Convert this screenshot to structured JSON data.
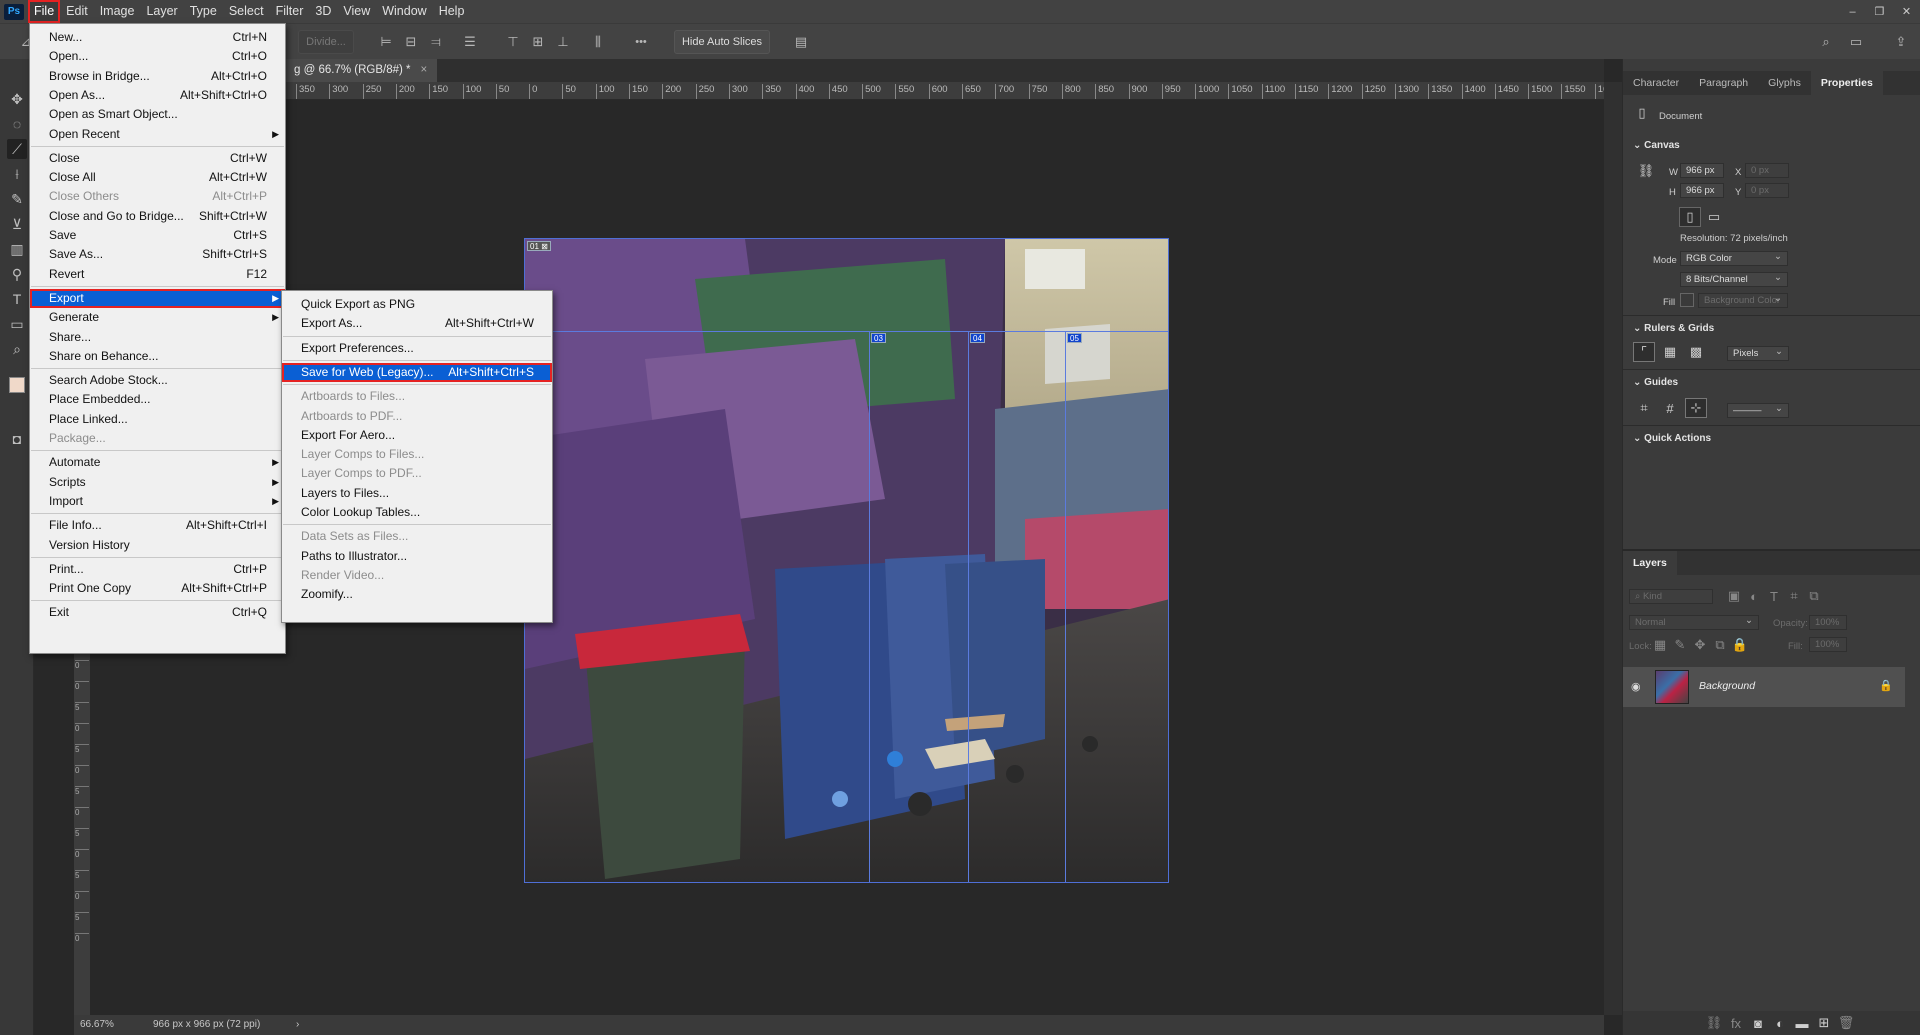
{
  "app": {
    "logo": "Ps"
  },
  "menubar": {
    "items": [
      "File",
      "Edit",
      "Image",
      "Layer",
      "Type",
      "Select",
      "Filter",
      "3D",
      "View",
      "Window",
      "Help"
    ]
  },
  "window_controls": {
    "minimize": "–",
    "restore": "❐",
    "close": "✕"
  },
  "options_bar": {
    "divide_label": "Divide...",
    "hide_auto_slices_label": "Hide Auto Slices",
    "more_label": "•••"
  },
  "document": {
    "tab_title": "g @ 66.7% (RGB/8#) *",
    "close_glyph": "×"
  },
  "rulers": {
    "h_labels": [
      "350",
      "300",
      "250",
      "200",
      "150",
      "100",
      "50",
      "0",
      "50",
      "100",
      "150",
      "200",
      "250",
      "300",
      "350",
      "400",
      "450",
      "500",
      "550",
      "600",
      "650",
      "700",
      "750",
      "800",
      "850",
      "900",
      "950",
      "1000",
      "1050",
      "1100",
      "1150",
      "1200",
      "1250",
      "1300",
      "1350",
      "1400",
      "1450",
      "1500",
      "1550",
      "16"
    ],
    "v_labels": [
      "0",
      "0",
      "5",
      "0",
      "5",
      "0",
      "5",
      "0",
      "5",
      "0",
      "5",
      "0",
      "5",
      "0"
    ]
  },
  "status_bar": {
    "zoom": "66.67%",
    "doc_info": "966 px x 966 px (72 ppi)",
    "arrow": "›"
  },
  "slices": [
    {
      "label": "03"
    },
    {
      "label": "04"
    },
    {
      "label": "05"
    }
  ],
  "file_menu": {
    "groups": [
      [
        {
          "label": "New...",
          "shortcut": "Ctrl+N"
        },
        {
          "label": "Open...",
          "shortcut": "Ctrl+O"
        },
        {
          "label": "Browse in Bridge...",
          "shortcut": "Alt+Ctrl+O"
        },
        {
          "label": "Open As...",
          "shortcut": "Alt+Shift+Ctrl+O"
        },
        {
          "label": "Open as Smart Object...",
          "shortcut": ""
        },
        {
          "label": "Open Recent",
          "shortcut": "",
          "submenu": true
        }
      ],
      [
        {
          "label": "Close",
          "shortcut": "Ctrl+W"
        },
        {
          "label": "Close All",
          "shortcut": "Alt+Ctrl+W"
        },
        {
          "label": "Close Others",
          "shortcut": "Alt+Ctrl+P",
          "disabled": true
        },
        {
          "label": "Close and Go to Bridge...",
          "shortcut": "Shift+Ctrl+W"
        },
        {
          "label": "Save",
          "shortcut": "Ctrl+S"
        },
        {
          "label": "Save As...",
          "shortcut": "Shift+Ctrl+S"
        },
        {
          "label": "Revert",
          "shortcut": "F12"
        }
      ],
      [
        {
          "label": "Export",
          "shortcut": "",
          "submenu": true,
          "highlighted": true
        },
        {
          "label": "Generate",
          "shortcut": "",
          "submenu": true
        },
        {
          "label": "Share...",
          "shortcut": ""
        },
        {
          "label": "Share on Behance...",
          "shortcut": ""
        }
      ],
      [
        {
          "label": "Search Adobe Stock...",
          "shortcut": ""
        },
        {
          "label": "Place Embedded...",
          "shortcut": ""
        },
        {
          "label": "Place Linked...",
          "shortcut": ""
        },
        {
          "label": "Package...",
          "shortcut": "",
          "disabled": true
        }
      ],
      [
        {
          "label": "Automate",
          "shortcut": "",
          "submenu": true
        },
        {
          "label": "Scripts",
          "shortcut": "",
          "submenu": true
        },
        {
          "label": "Import",
          "shortcut": "",
          "submenu": true
        }
      ],
      [
        {
          "label": "File Info...",
          "shortcut": "Alt+Shift+Ctrl+I"
        },
        {
          "label": "Version History",
          "shortcut": ""
        }
      ],
      [
        {
          "label": "Print...",
          "shortcut": "Ctrl+P"
        },
        {
          "label": "Print One Copy",
          "shortcut": "Alt+Shift+Ctrl+P"
        }
      ],
      [
        {
          "label": "Exit",
          "shortcut": "Ctrl+Q"
        }
      ]
    ]
  },
  "export_menu": {
    "groups": [
      [
        {
          "label": "Quick Export as PNG",
          "shortcut": ""
        },
        {
          "label": "Export As...",
          "shortcut": "Alt+Shift+Ctrl+W"
        }
      ],
      [
        {
          "label": "Export Preferences...",
          "shortcut": ""
        }
      ],
      [
        {
          "label": "Save for Web (Legacy)...",
          "shortcut": "Alt+Shift+Ctrl+S",
          "highlighted": true
        }
      ],
      [
        {
          "label": "Artboards to Files...",
          "shortcut": "",
          "disabled": true
        },
        {
          "label": "Artboards to PDF...",
          "shortcut": "",
          "disabled": true
        },
        {
          "label": "Export For Aero...",
          "shortcut": ""
        },
        {
          "label": "Layer Comps to Files...",
          "shortcut": "",
          "disabled": true
        },
        {
          "label": "Layer Comps to PDF...",
          "shortcut": "",
          "disabled": true
        },
        {
          "label": "Layers to Files...",
          "shortcut": ""
        },
        {
          "label": "Color Lookup Tables...",
          "shortcut": ""
        }
      ],
      [
        {
          "label": "Data Sets as Files...",
          "shortcut": "",
          "disabled": true
        },
        {
          "label": "Paths to Illustrator...",
          "shortcut": ""
        },
        {
          "label": "Render Video...",
          "shortcut": "",
          "disabled": true
        },
        {
          "label": "Zoomify...",
          "shortcut": ""
        }
      ]
    ]
  },
  "properties": {
    "tabs": [
      "Character",
      "Paragraph",
      "Glyphs",
      "Properties"
    ],
    "doc_label": "Document",
    "canvas_head": "Canvas",
    "w_label": "W",
    "w_value": "966 px",
    "h_label": "H",
    "h_value": "966 px",
    "x_label": "X",
    "x_value": "0 px",
    "y_label": "Y",
    "y_value": "0 px",
    "resolution": "Resolution: 72 pixels/inch",
    "mode_label": "Mode",
    "mode_value": "RGB Color",
    "bits_value": "8 Bits/Channel",
    "fill_label": "Fill",
    "fill_value": "Background Color",
    "rulers_head": "Rulers & Grids",
    "units_value": "Pixels",
    "guides_head": "Guides",
    "quick_actions_head": "Quick Actions"
  },
  "layers": {
    "tab": "Layers",
    "kind_placeholder": "Kind",
    "blend_mode": "Normal",
    "opacity_label": "Opacity:",
    "opacity_value": "100%",
    "lock_label": "Lock:",
    "fill_label": "Fill:",
    "fill_value": "100%",
    "layer_name": "Background"
  }
}
